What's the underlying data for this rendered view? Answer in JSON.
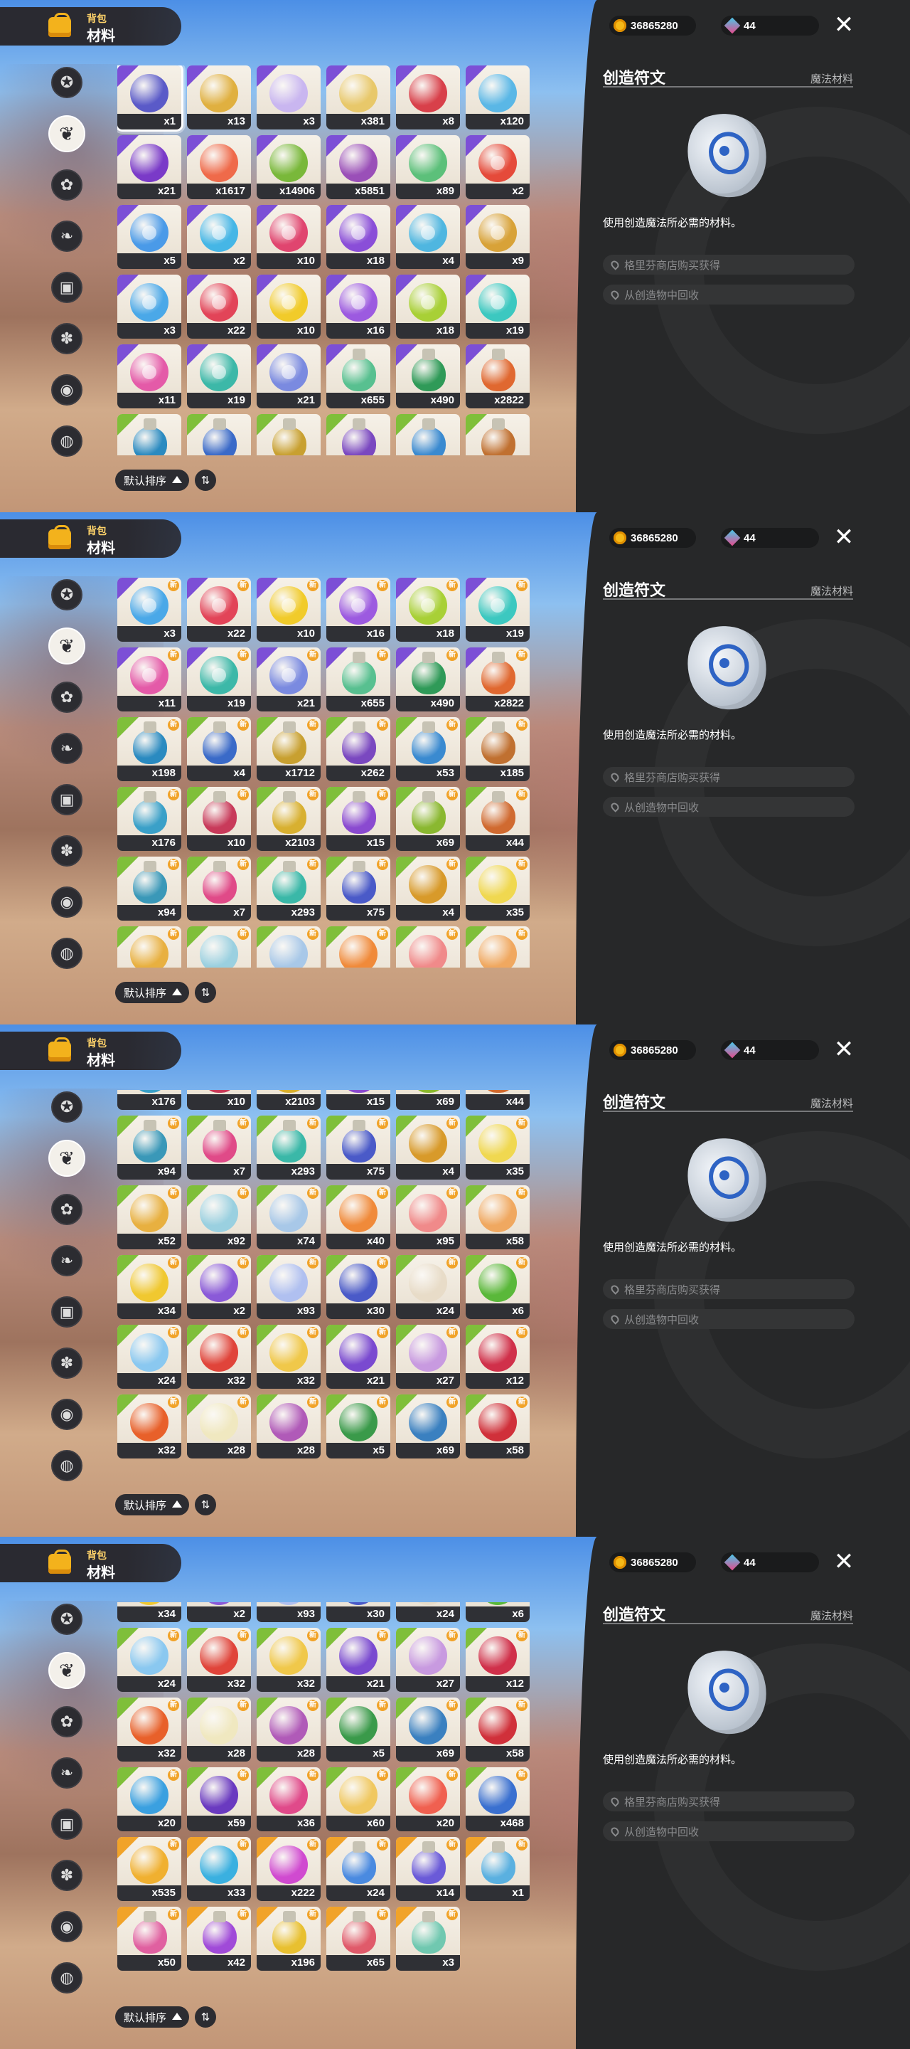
{
  "currency": {
    "coins": "36865280",
    "gems": "44"
  },
  "header": {
    "subtitle": "背包",
    "title": "材料"
  },
  "categories": [
    "star-badge-icon",
    "leaf-icon",
    "flower-badge-icon",
    "sprout-icon",
    "box-icon",
    "paw-icon",
    "acorn-icon",
    "pot-icon"
  ],
  "sort": {
    "label": "默认排序"
  },
  "detail": {
    "name": "创造符文",
    "type": "魔法材料",
    "description": "使用创造魔法所必需的材料。",
    "sources": [
      "格里芬商店购买获得",
      "从创造物中回收"
    ]
  },
  "colors": {
    "purple": "#7c4fd6",
    "green": "#7fbf3a",
    "orange": "#f1a329",
    "panel": "#272829"
  },
  "panels": [
    {
      "offset": 0,
      "rows": [
        [
          {
            "c": "#5a5ac8",
            "q": "x1",
            "t": "purple",
            "s": true
          },
          {
            "c": "#e0b040",
            "q": "x13",
            "t": "purple"
          },
          {
            "c": "#c9b6f0",
            "q": "x3",
            "t": "purple"
          },
          {
            "c": "#e8c86a",
            "q": "x381",
            "t": "purple"
          },
          {
            "c": "#d8404a",
            "q": "x8",
            "t": "purple"
          },
          {
            "c": "#5ab7e6",
            "q": "x120",
            "t": "purple"
          }
        ],
        [
          {
            "c": "#7a3ac8",
            "q": "x21",
            "t": "purple"
          },
          {
            "c": "#ef6a4a",
            "q": "x1617",
            "t": "purple"
          },
          {
            "c": "#79b83a",
            "q": "x14906",
            "t": "purple"
          },
          {
            "c": "#9a4fb8",
            "q": "x5851",
            "t": "purple"
          },
          {
            "c": "#5cc07a",
            "q": "x89",
            "t": "purple"
          },
          {
            "c": "#e54a3a",
            "q": "x2",
            "t": "purple",
            "r": 1
          }
        ],
        [
          {
            "c": "#4a9ae8",
            "q": "x5",
            "t": "purple",
            "r": 1
          },
          {
            "c": "#45b6e6",
            "q": "x2",
            "t": "purple",
            "r": 1
          },
          {
            "c": "#e0456f",
            "q": "x10",
            "t": "purple",
            "r": 1
          },
          {
            "c": "#8a4ed8",
            "q": "x18",
            "t": "purple",
            "r": 1
          },
          {
            "c": "#4fb6e0",
            "q": "x4",
            "t": "purple",
            "r": 1
          },
          {
            "c": "#d8a238",
            "q": "x9",
            "t": "purple",
            "r": 1
          }
        ],
        [
          {
            "c": "#4aa8e8",
            "q": "x3",
            "t": "purple",
            "r": 1
          },
          {
            "c": "#e24458",
            "q": "x22",
            "t": "purple",
            "r": 1
          },
          {
            "c": "#f1cb2a",
            "q": "x10",
            "t": "purple",
            "r": 1
          },
          {
            "c": "#9c5ae0",
            "q": "x16",
            "t": "purple",
            "r": 1
          },
          {
            "c": "#a8d036",
            "q": "x18",
            "t": "purple",
            "r": 1
          },
          {
            "c": "#3cc8c0",
            "q": "x19",
            "t": "purple",
            "r": 1
          }
        ],
        [
          {
            "c": "#e45aa8",
            "q": "x11",
            "t": "purple",
            "r": 1
          },
          {
            "c": "#3cb8a8",
            "q": "x19",
            "t": "purple",
            "r": 1
          },
          {
            "c": "#7a8ae0",
            "q": "x21",
            "t": "purple",
            "r": 1
          },
          {
            "c": "#58c090",
            "q": "x655",
            "t": "purple",
            "p": 1
          },
          {
            "c": "#2f9a58",
            "q": "x490",
            "t": "purple",
            "p": 1
          },
          {
            "c": "#e06830",
            "q": "x2822",
            "t": "purple",
            "p": 1
          }
        ],
        [
          {
            "c": "#2a8ac0",
            "q": "",
            "t": "green",
            "p": 1
          },
          {
            "c": "#3a6ac8",
            "q": "",
            "t": "green",
            "p": 1
          },
          {
            "c": "#c8a030",
            "q": "",
            "t": "green",
            "p": 1
          },
          {
            "c": "#7a48c0",
            "q": "",
            "t": "green",
            "p": 1
          },
          {
            "c": "#3a8ad0",
            "q": "",
            "t": "green",
            "p": 1
          },
          {
            "c": "#c07030",
            "q": "",
            "t": "green",
            "p": 1
          }
        ]
      ]
    },
    {
      "offset": 0,
      "rows": [
        [
          {
            "c": "#4aa8e8",
            "q": "x3",
            "t": "purple",
            "r": 1,
            "n": 1
          },
          {
            "c": "#e24458",
            "q": "x22",
            "t": "purple",
            "r": 1,
            "n": 1
          },
          {
            "c": "#f1cb2a",
            "q": "x10",
            "t": "purple",
            "r": 1,
            "n": 1
          },
          {
            "c": "#9c5ae0",
            "q": "x16",
            "t": "purple",
            "r": 1,
            "n": 1
          },
          {
            "c": "#a8d036",
            "q": "x18",
            "t": "purple",
            "r": 1,
            "n": 1
          },
          {
            "c": "#3cc8c0",
            "q": "x19",
            "t": "purple",
            "r": 1,
            "n": 1
          }
        ],
        [
          {
            "c": "#e45aa8",
            "q": "x11",
            "t": "purple",
            "r": 1,
            "n": 1
          },
          {
            "c": "#3cb8a8",
            "q": "x19",
            "t": "purple",
            "r": 1,
            "n": 1
          },
          {
            "c": "#7a8ae0",
            "q": "x21",
            "t": "purple",
            "r": 1,
            "n": 1
          },
          {
            "c": "#58c090",
            "q": "x655",
            "t": "purple",
            "p": 1,
            "n": 1
          },
          {
            "c": "#2f9a58",
            "q": "x490",
            "t": "purple",
            "p": 1,
            "n": 1
          },
          {
            "c": "#e06830",
            "q": "x2822",
            "t": "purple",
            "p": 1,
            "n": 1
          }
        ],
        [
          {
            "c": "#2a8ac0",
            "q": "x198",
            "t": "green",
            "p": 1,
            "n": 1
          },
          {
            "c": "#3a6ac8",
            "q": "x4",
            "t": "green",
            "p": 1,
            "n": 1
          },
          {
            "c": "#c8a030",
            "q": "x1712",
            "t": "green",
            "p": 1,
            "n": 1
          },
          {
            "c": "#7a48c0",
            "q": "x262",
            "t": "green",
            "p": 1,
            "n": 1
          },
          {
            "c": "#3a8ad0",
            "q": "x53",
            "t": "green",
            "p": 1,
            "n": 1
          },
          {
            "c": "#c07030",
            "q": "x185",
            "t": "green",
            "p": 1,
            "n": 1
          }
        ],
        [
          {
            "c": "#3aa0c8",
            "q": "x176",
            "t": "green",
            "p": 1,
            "n": 1
          },
          {
            "c": "#c83a5a",
            "q": "x10",
            "t": "green",
            "p": 1,
            "n": 1
          },
          {
            "c": "#d8b030",
            "q": "x2103",
            "t": "green",
            "p": 1,
            "n": 1
          },
          {
            "c": "#8a4ad0",
            "q": "x15",
            "t": "green",
            "p": 1,
            "n": 1
          },
          {
            "c": "#8ab830",
            "q": "x69",
            "t": "green",
            "p": 1,
            "n": 1
          },
          {
            "c": "#d06a30",
            "q": "x44",
            "t": "green",
            "p": 1,
            "n": 1
          }
        ],
        [
          {
            "c": "#3a98b8",
            "q": "x94",
            "t": "green",
            "p": 1,
            "n": 1
          },
          {
            "c": "#e04a88",
            "q": "x7",
            "t": "green",
            "p": 1,
            "n": 1
          },
          {
            "c": "#3ab8a8",
            "q": "x293",
            "t": "green",
            "p": 1,
            "n": 1
          },
          {
            "c": "#4a5ac8",
            "q": "x75",
            "t": "green",
            "p": 1,
            "n": 1
          },
          {
            "c": "#d89a2a",
            "q": "x4",
            "t": "green",
            "n": 1
          },
          {
            "c": "#f0d850",
            "q": "x35",
            "t": "green",
            "n": 1
          }
        ],
        [
          {
            "c": "#e8b040",
            "q": "",
            "t": "green",
            "n": 1
          },
          {
            "c": "#9ad0e0",
            "q": "",
            "t": "green",
            "n": 1
          },
          {
            "c": "#a8c8e8",
            "q": "",
            "t": "green",
            "n": 1
          },
          {
            "c": "#f08a3a",
            "q": "",
            "t": "green",
            "n": 1
          },
          {
            "c": "#f08a8a",
            "q": "",
            "t": "green",
            "n": 1
          },
          {
            "c": "#f0a860",
            "q": "",
            "t": "green",
            "n": 1
          }
        ]
      ]
    },
    {
      "offset": -62,
      "rows": [
        [
          {
            "c": "#3aa0c8",
            "q": "x176",
            "t": "green",
            "p": 1
          },
          {
            "c": "#c83a5a",
            "q": "x10",
            "t": "green",
            "p": 1
          },
          {
            "c": "#d8b030",
            "q": "x2103",
            "t": "green",
            "p": 1
          },
          {
            "c": "#8a4ad0",
            "q": "x15",
            "t": "green",
            "p": 1
          },
          {
            "c": "#8ab830",
            "q": "x69",
            "t": "green",
            "p": 1
          },
          {
            "c": "#d06a30",
            "q": "x44",
            "t": "green",
            "p": 1
          }
        ],
        [
          {
            "c": "#3a98b8",
            "q": "x94",
            "t": "green",
            "p": 1,
            "n": 1
          },
          {
            "c": "#e04a88",
            "q": "x7",
            "t": "green",
            "p": 1,
            "n": 1
          },
          {
            "c": "#3ab8a8",
            "q": "x293",
            "t": "green",
            "p": 1,
            "n": 1
          },
          {
            "c": "#4a5ac8",
            "q": "x75",
            "t": "green",
            "p": 1,
            "n": 1
          },
          {
            "c": "#d89a2a",
            "q": "x4",
            "t": "green",
            "n": 1
          },
          {
            "c": "#f0d850",
            "q": "x35",
            "t": "green",
            "n": 1
          }
        ],
        [
          {
            "c": "#e8b040",
            "q": "x52",
            "t": "green",
            "n": 1
          },
          {
            "c": "#9ad0e0",
            "q": "x92",
            "t": "green",
            "n": 1
          },
          {
            "c": "#a8c8e8",
            "q": "x74",
            "t": "green",
            "n": 1
          },
          {
            "c": "#f08a3a",
            "q": "x40",
            "t": "green",
            "n": 1
          },
          {
            "c": "#f08a8a",
            "q": "x95",
            "t": "green",
            "n": 1
          },
          {
            "c": "#f0a860",
            "q": "x58",
            "t": "green",
            "n": 1
          }
        ],
        [
          {
            "c": "#f0c830",
            "q": "x34",
            "t": "green",
            "n": 1
          },
          {
            "c": "#8a5ad8",
            "q": "x2",
            "t": "green",
            "n": 1
          },
          {
            "c": "#b0c0f0",
            "q": "x93",
            "t": "green",
            "n": 1
          },
          {
            "c": "#4a5ac8",
            "q": "x30",
            "t": "green",
            "n": 1
          },
          {
            "c": "#e8dcc8",
            "q": "x24",
            "t": "green",
            "n": 1
          },
          {
            "c": "#5ab83a",
            "q": "x6",
            "t": "green",
            "n": 1
          }
        ],
        [
          {
            "c": "#8ac8f0",
            "q": "x24",
            "t": "green",
            "n": 1
          },
          {
            "c": "#e0443a",
            "q": "x32",
            "t": "green",
            "n": 1
          },
          {
            "c": "#f0c84a",
            "q": "x32",
            "t": "green",
            "n": 1
          },
          {
            "c": "#7a4ad0",
            "q": "x21",
            "t": "green",
            "n": 1
          },
          {
            "c": "#c89ae0",
            "q": "x27",
            "t": "green",
            "n": 1
          },
          {
            "c": "#d0304a",
            "q": "x12",
            "t": "green",
            "n": 1
          }
        ],
        [
          {
            "c": "#e8602a",
            "q": "x32",
            "t": "green",
            "n": 1
          },
          {
            "c": "#f0e8c0",
            "q": "x28",
            "t": "green",
            "n": 1
          },
          {
            "c": "#b05ab8",
            "q": "x28",
            "t": "green",
            "n": 1
          },
          {
            "c": "#3a9a4a",
            "q": "x5",
            "t": "green",
            "n": 1
          },
          {
            "c": "#3a80c0",
            "q": "x69",
            "t": "green",
            "n": 1
          },
          {
            "c": "#d0303a",
            "q": "x58",
            "t": "green",
            "n": 1
          }
        ]
      ]
    },
    {
      "offset": -62,
      "rows": [
        [
          {
            "c": "#f0c830",
            "q": "x34",
            "t": "green",
            "n": 1
          },
          {
            "c": "#8a5ad8",
            "q": "x2",
            "t": "green",
            "n": 1
          },
          {
            "c": "#b0c0f0",
            "q": "x93",
            "t": "green",
            "n": 1
          },
          {
            "c": "#4a5ac8",
            "q": "x30",
            "t": "green",
            "n": 1
          },
          {
            "c": "#e8dcc8",
            "q": "x24",
            "t": "green",
            "n": 1
          },
          {
            "c": "#5ab83a",
            "q": "x6",
            "t": "green",
            "n": 1
          }
        ],
        [
          {
            "c": "#8ac8f0",
            "q": "x24",
            "t": "green",
            "n": 1
          },
          {
            "c": "#e0443a",
            "q": "x32",
            "t": "green",
            "n": 1
          },
          {
            "c": "#f0c84a",
            "q": "x32",
            "t": "green",
            "n": 1
          },
          {
            "c": "#7a4ad0",
            "q": "x21",
            "t": "green",
            "n": 1
          },
          {
            "c": "#c89ae0",
            "q": "x27",
            "t": "green",
            "n": 1
          },
          {
            "c": "#d0304a",
            "q": "x12",
            "t": "green",
            "n": 1
          }
        ],
        [
          {
            "c": "#e8602a",
            "q": "x32",
            "t": "green",
            "n": 1
          },
          {
            "c": "#f0e8c0",
            "q": "x28",
            "t": "green",
            "n": 1
          },
          {
            "c": "#b05ab8",
            "q": "x28",
            "t": "green",
            "n": 1
          },
          {
            "c": "#3a9a4a",
            "q": "x5",
            "t": "green",
            "n": 1
          },
          {
            "c": "#3a80c0",
            "q": "x69",
            "t": "green",
            "n": 1
          },
          {
            "c": "#d0303a",
            "q": "x58",
            "t": "green",
            "n": 1
          }
        ],
        [
          {
            "c": "#3aa0e0",
            "q": "x20",
            "t": "green",
            "n": 1
          },
          {
            "c": "#6a3ac0",
            "q": "x59",
            "t": "green",
            "n": 1
          },
          {
            "c": "#e04a8a",
            "q": "x36",
            "t": "green",
            "n": 1
          },
          {
            "c": "#f0c860",
            "q": "x60",
            "t": "green",
            "n": 1
          },
          {
            "c": "#f06050",
            "q": "x20",
            "t": "green",
            "n": 1
          },
          {
            "c": "#3a70d0",
            "q": "x468",
            "t": "green",
            "n": 1
          }
        ],
        [
          {
            "c": "#f0b030",
            "q": "x535",
            "t": "orange",
            "n": 1
          },
          {
            "c": "#3ab0e0",
            "q": "x33",
            "t": "orange",
            "n": 1
          },
          {
            "c": "#d04ad0",
            "q": "x222",
            "t": "orange",
            "n": 1
          },
          {
            "c": "#4a8ae0",
            "q": "x24",
            "t": "orange",
            "p": 1,
            "n": 1
          },
          {
            "c": "#6a5ad8",
            "q": "x14",
            "t": "orange",
            "p": 1,
            "n": 1
          },
          {
            "c": "#5ab0e0",
            "q": "x1",
            "t": "orange",
            "p": 1,
            "n": 1
          }
        ],
        [
          {
            "c": "#e060a0",
            "q": "x50",
            "t": "orange",
            "p": 1,
            "n": 1
          },
          {
            "c": "#a04ad8",
            "q": "x42",
            "t": "orange",
            "p": 1,
            "n": 1
          },
          {
            "c": "#e8c030",
            "q": "x196",
            "t": "orange",
            "p": 1,
            "n": 1
          },
          {
            "c": "#e05a6a",
            "q": "x65",
            "t": "orange",
            "p": 1,
            "n": 1
          },
          {
            "c": "#70c8b0",
            "q": "x3",
            "t": "orange",
            "p": 1,
            "n": 1
          }
        ]
      ]
    }
  ]
}
